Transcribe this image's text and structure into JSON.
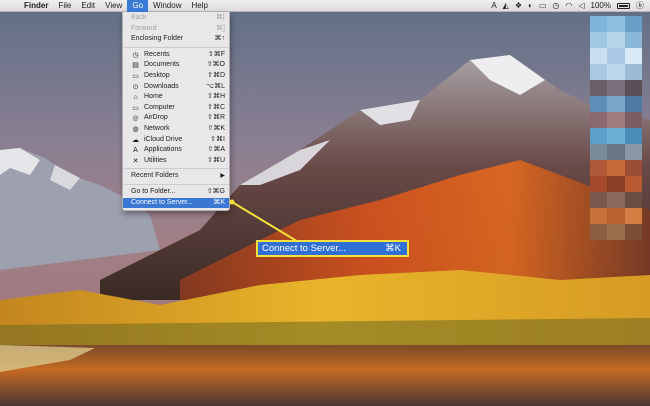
{
  "menubar": {
    "apple": "",
    "items": [
      "Finder",
      "File",
      "Edit",
      "View",
      "Go",
      "Window",
      "Help"
    ],
    "status_icons": [
      "adobe-icon",
      "airplay-icon",
      "dropbox-icon",
      "flux-icon",
      "airplay-display-icon",
      "time-machine-icon",
      "wifi-icon",
      "volume-icon"
    ],
    "battery_percent": "100%",
    "bluetooth": "ⓑ"
  },
  "go_menu": {
    "items": [
      {
        "label": "Back",
        "shortcut": "⌘[",
        "disabled": true
      },
      {
        "label": "Forward",
        "shortcut": "⌘]",
        "disabled": true
      },
      {
        "label": "Enclosing Folder",
        "shortcut": "⌘↑"
      },
      {
        "sep": true
      },
      {
        "label": "Recents",
        "shortcut": "⇧⌘F",
        "icon": "recents-icon"
      },
      {
        "label": "Documents",
        "shortcut": "⇧⌘O",
        "icon": "documents-icon"
      },
      {
        "label": "Desktop",
        "shortcut": "⇧⌘D",
        "icon": "desktop-icon"
      },
      {
        "label": "Downloads",
        "shortcut": "⌥⌘L",
        "icon": "downloads-icon"
      },
      {
        "label": "Home",
        "shortcut": "⇧⌘H",
        "icon": "home-icon"
      },
      {
        "label": "Computer",
        "shortcut": "⇧⌘C",
        "icon": "computer-icon"
      },
      {
        "label": "AirDrop",
        "shortcut": "⇧⌘R",
        "icon": "airdrop-icon"
      },
      {
        "label": "Network",
        "shortcut": "⇧⌘K",
        "icon": "network-icon"
      },
      {
        "label": "iCloud Drive",
        "shortcut": "⇧⌘I",
        "icon": "icloud-icon"
      },
      {
        "label": "Applications",
        "shortcut": "⇧⌘A",
        "icon": "applications-icon"
      },
      {
        "label": "Utilities",
        "shortcut": "⇧⌘U",
        "icon": "utilities-icon"
      },
      {
        "sep": true
      },
      {
        "label": "Recent Folders",
        "submenu": true
      },
      {
        "sep": true
      },
      {
        "label": "Go to Folder...",
        "shortcut": "⇧⌘G"
      },
      {
        "label": "Connect to Server...",
        "shortcut": "⌘K",
        "highlighted": true
      }
    ]
  },
  "callout": {
    "label": "Connect to Server...",
    "shortcut": "⌘K"
  },
  "colors": {
    "menu_highlight": "#3b78d4",
    "callout_border": "#f5e23a",
    "callout_fill": "#2f6fd6"
  }
}
